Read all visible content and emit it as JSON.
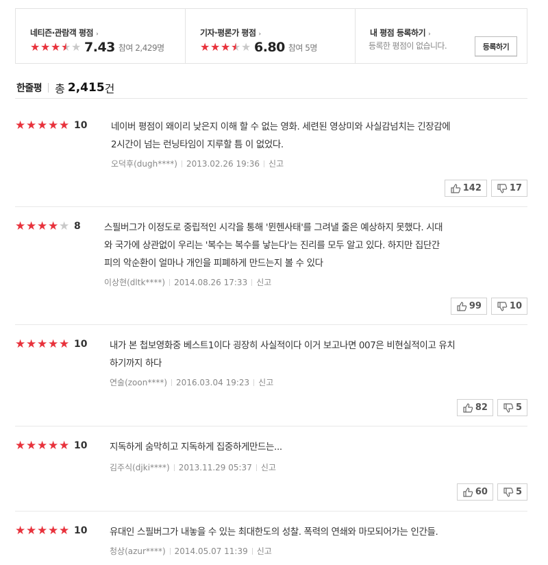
{
  "summary": {
    "audience": {
      "title": "네티즌·관람객 평점",
      "arrow": "›",
      "score": "7.43",
      "participants": "참여 2,429명",
      "stars": 3.7
    },
    "critic": {
      "title": "기자·평론가 평점",
      "arrow": "›",
      "score": "6.80",
      "participants": "참여 5명",
      "stars": 3.4
    },
    "mine": {
      "title": "내 평점 등록하기",
      "arrow": "›",
      "empty_text": "등록한 평점이 없습니다.",
      "button_label": "등록하기"
    }
  },
  "list_header": {
    "label": "한줄평",
    "total_prefix": "총",
    "total_count": "2,415",
    "total_unit": "건"
  },
  "colors": {
    "star_on": "#e8323c",
    "star_off": "#c9c9c9"
  },
  "reviews": [
    {
      "stars": 5,
      "score": "10",
      "lines": [
        "네이버 평점이 왜이리 낮은지 이해 할 수 없는 영화. 세련된 영상미와 사실감넘치는 긴장감에",
        "2시간이 넘는 런닝타임이 지루할 틈 이 없었다."
      ],
      "author": "오덕후(dugh****)",
      "date": "2013.02.26 19:36",
      "report": "신고",
      "likes": "142",
      "dislikes": "17"
    },
    {
      "stars": 4,
      "score": "8",
      "lines": [
        "스필버그가 이정도로 중립적인 시각을 통해 '뮌헨사태'를 그려낼 줄은 예상하지 못했다. 시대",
        "와 국가에 상관없이 우리는 '복수는 복수를 낳는다'는 진리를 모두 알고 있다. 하지만 집단간",
        "피의 악순환이 얼마나 개인을 피폐하게 만드는지 볼 수 있다"
      ],
      "author": "이상현(dltk****)",
      "date": "2014.08.26 17:33",
      "report": "신고",
      "likes": "99",
      "dislikes": "10"
    },
    {
      "stars": 5,
      "score": "10",
      "lines": [
        "내가 본 첩보영화중 베스트1이다 굉장히 사실적이다 이거 보고나면 007은 비현실적이고 유치",
        "하기까지 하다"
      ],
      "author": "연술(zoon****)",
      "date": "2016.03.04 19:23",
      "report": "신고",
      "likes": "82",
      "dislikes": "5"
    },
    {
      "stars": 5,
      "score": "10",
      "lines": [
        "지독하게 숨막히고 지독하게 집중하게만드는..."
      ],
      "author": "김주식(djki****)",
      "date": "2013.11.29 05:37",
      "report": "신고",
      "likes": "60",
      "dislikes": "5"
    },
    {
      "stars": 5,
      "score": "10",
      "lines": [
        "유대인 스필버그가 내놓을 수 있는 최대한도의 성찰. 폭력의 연쇄와 마모되어가는 인간들."
      ],
      "author": "청상(azur****)",
      "date": "2014.05.07 11:39",
      "report": "신고",
      "likes": "",
      "dislikes": ""
    }
  ]
}
